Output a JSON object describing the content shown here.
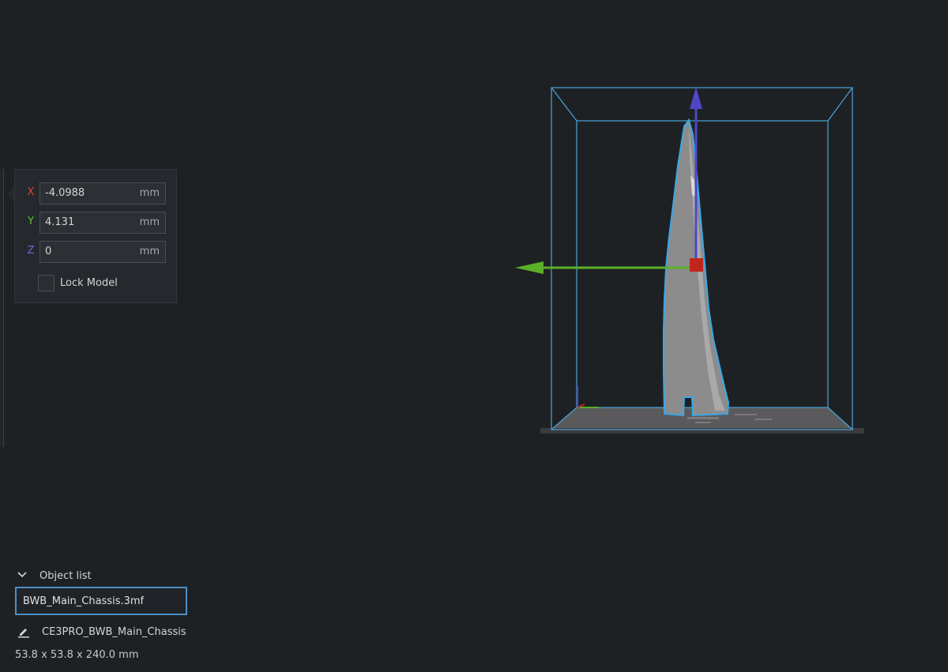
{
  "move_panel": {
    "axes": [
      {
        "label": "X",
        "value": "-4.0988",
        "unit": "mm",
        "color": "#e0443a"
      },
      {
        "label": "Y",
        "value": "4.131",
        "unit": "mm",
        "color": "#5ac23a"
      },
      {
        "label": "Z",
        "value": "0",
        "unit": "mm",
        "color": "#6a6ae0"
      }
    ],
    "lock_model_label": "Lock Model",
    "lock_model_checked": false
  },
  "object_list": {
    "title": "Object list",
    "expanded": true,
    "file_name": "BWB_Main_Chassis.3mf"
  },
  "job": {
    "name": "CE3PRO_BWB_Main_Chassis",
    "dimensions": "53.8 x 53.8 x 240.0 mm"
  },
  "icons": {
    "chevron": "chevron-down-icon",
    "job": "pencil-icon"
  },
  "colors": {
    "background": "#1e2124",
    "build_volume_outline": "#4aa3d8",
    "selection_outline": "#3aa8e8",
    "model_fill": "#8c8c8c",
    "x_arrow": "#5ab028",
    "z_arrow": "#5046c8",
    "move_handle": "#c0261d"
  }
}
